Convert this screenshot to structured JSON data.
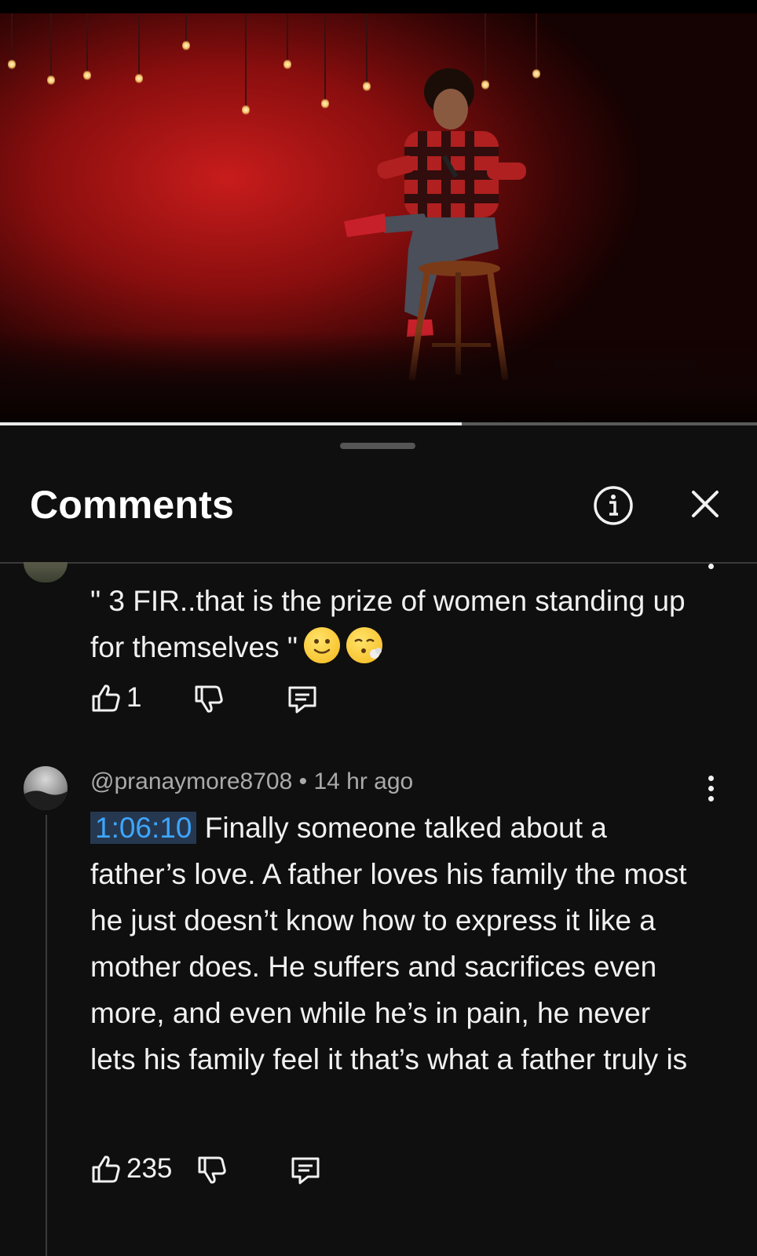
{
  "video": {
    "progress_percent": 61
  },
  "comments_panel": {
    "title": "Comments",
    "info_icon": "info-icon",
    "close_icon": "close-icon"
  },
  "comments": [
    {
      "text": "\" 3 FIR..that is the prize of women standing up for themselves \"",
      "emojis": [
        "slightly-smiling-face",
        "face-exhaling"
      ],
      "likes": "1"
    },
    {
      "author": "@pranaymore8708",
      "time": "14 hr ago",
      "timestamp_link": "1:06:10",
      "text": " Finally someone talked about a father’s love. A father loves his family the most he just doesn’t know how to express it like a mother does. He suffers and sacrifices even more, and even while he’s in pain, he never lets his family feel it that’s what a father truly is",
      "likes": "235"
    }
  ],
  "colors": {
    "background": "#0f0f0f",
    "text": "#f1f1f1",
    "meta": "#aaaaaa",
    "link": "#3ea6ff"
  }
}
